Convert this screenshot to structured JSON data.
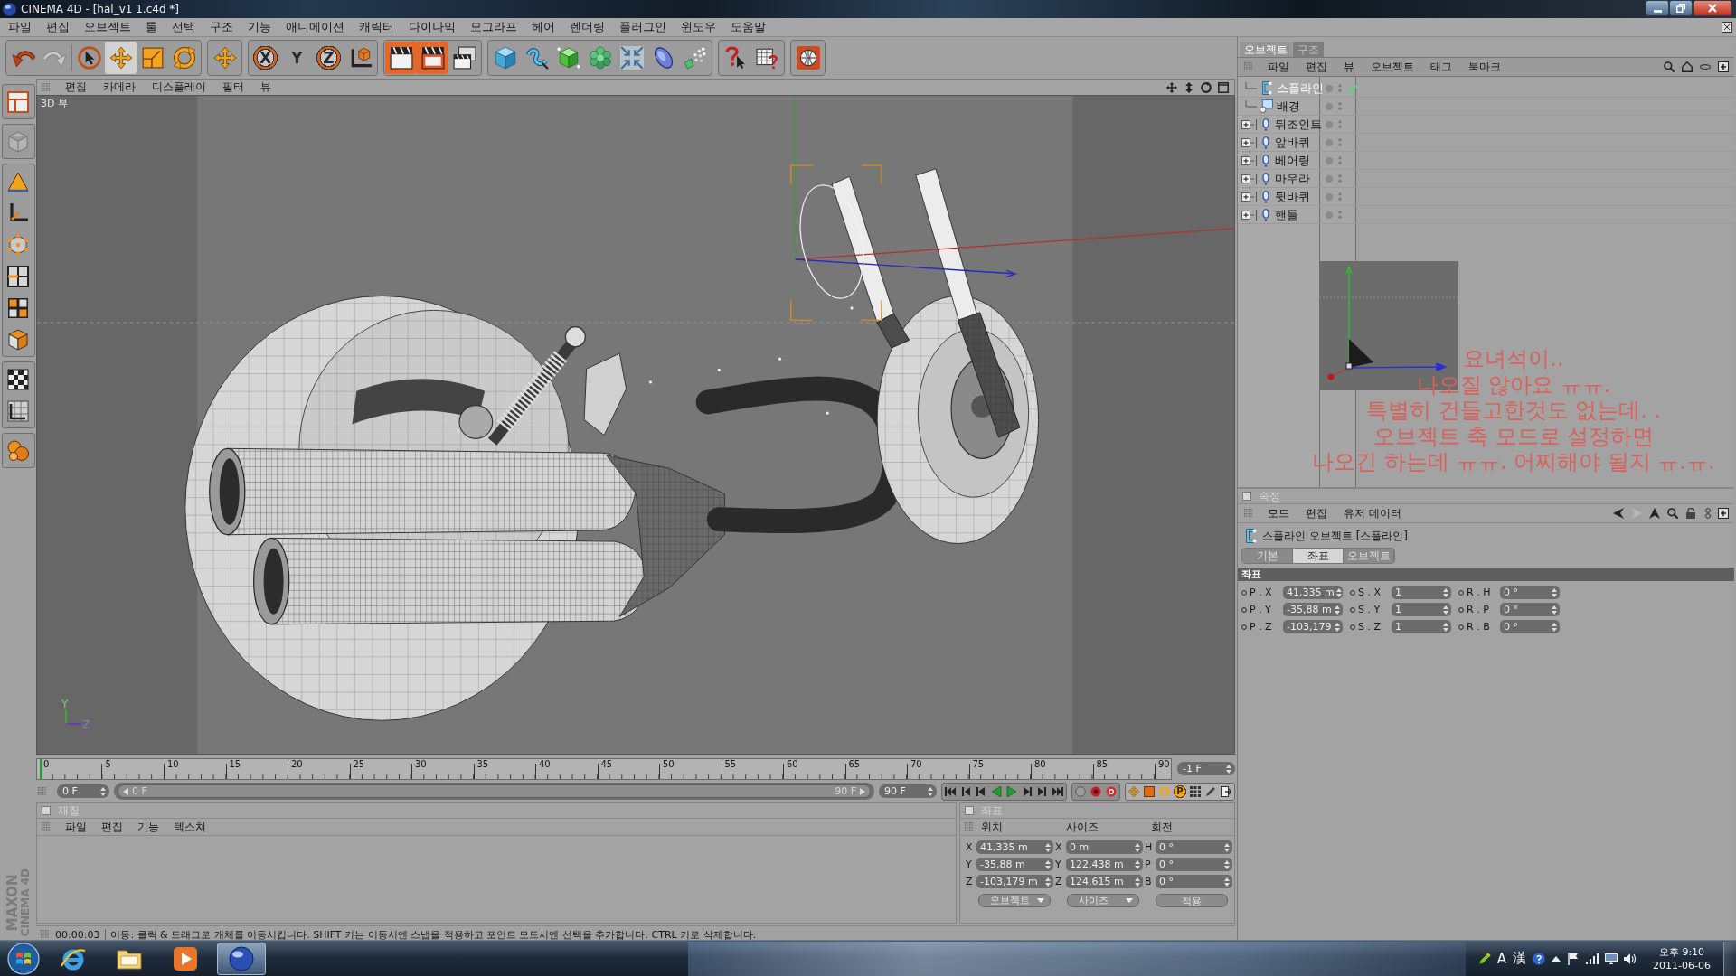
{
  "window": {
    "title": "CINEMA 4D - [hal_v1 1.c4d *]"
  },
  "menu_bar": [
    "파일",
    "편집",
    "오브젝트",
    "툴",
    "선택",
    "구조",
    "기능",
    "애니메이션",
    "캐릭터",
    "다이나믹",
    "모그라프",
    "헤어",
    "렌더링",
    "플러그인",
    "윈도우",
    "도움말"
  ],
  "toolbar": {
    "history": [
      {
        "kind": "undo",
        "disabled": false
      },
      {
        "kind": "redo",
        "disabled": true
      }
    ],
    "tools": [
      {
        "kind": "select",
        "selected": false
      },
      {
        "kind": "move",
        "selected": true
      },
      {
        "kind": "scale",
        "selected": false
      },
      {
        "kind": "rotate",
        "selected": false
      }
    ],
    "axes": [
      {
        "label": "X",
        "on": true
      },
      {
        "label": "Y",
        "on": false
      },
      {
        "label": "Z",
        "on": true
      }
    ]
  },
  "viewport": {
    "menu": [
      "편집",
      "카메라",
      "디스플레이",
      "필터",
      "뷰"
    ],
    "label": "3D 뷰",
    "gizmo_labels": [
      "Y",
      "Z"
    ]
  },
  "timeline": {
    "ticks": [
      "0",
      "5",
      "10",
      "15",
      "20",
      "25",
      "30",
      "35",
      "40",
      "45",
      "50",
      "55",
      "60",
      "65",
      "70",
      "75",
      "80",
      "85",
      "90"
    ],
    "current_frame": "-1 F",
    "start": "0 F",
    "range": {
      "start": "0 F",
      "end": "90 F",
      "level": 1
    },
    "end": "90 F",
    "param_key": "P"
  },
  "material_manager": {
    "title": "재질",
    "menu": [
      "파일",
      "편집",
      "기능",
      "텍스쳐"
    ]
  },
  "coordinates": {
    "title": "좌표",
    "columns": [
      "위치",
      "사이즈",
      "회전"
    ],
    "rows": [
      [
        {
          "axis": "X",
          "value": "41,335 m"
        },
        {
          "axis": "X",
          "value": "0 m"
        },
        {
          "axis": "H",
          "value": "0 °"
        }
      ],
      [
        {
          "axis": "Y",
          "value": "-35,88 m"
        },
        {
          "axis": "Y",
          "value": "122,438 m"
        },
        {
          "axis": "P",
          "value": "0 °"
        }
      ],
      [
        {
          "axis": "Z",
          "value": "-103,179 m"
        },
        {
          "axis": "Z",
          "value": "124,615 m"
        },
        {
          "axis": "B",
          "value": "0 °"
        }
      ]
    ],
    "dropdowns": [
      "오브젝트",
      "사이즈"
    ],
    "apply": "적용"
  },
  "status_bar": {
    "time": "00:00:03",
    "message": "이동: 클릭 & 드래그로 개체를 이동시킵니다. SHIFT 키는 이동시엔 스냅을 적용하고 포인트 모드시엔 선택을 추가합니다. CTRL 키로 삭제합니다."
  },
  "logo": [
    "MAXON",
    "CINEMA 4D"
  ],
  "object_manager": {
    "tabs": [
      {
        "label": "오브젝트",
        "selected": true
      },
      {
        "label": "구조",
        "selected": false
      }
    ],
    "menu": [
      "파일",
      "편집",
      "뷰",
      "오브젝트",
      "태그",
      "북마크"
    ],
    "objects": [
      {
        "name": "스플라인",
        "kind": "spline",
        "selected": true,
        "collapsed": false,
        "enabled_check": true
      },
      {
        "name": "배경",
        "kind": "background",
        "selected": false,
        "collapsed": false,
        "enabled_check": false
      },
      {
        "name": "뒤조인트",
        "kind": "null",
        "selected": false,
        "collapsed": true,
        "enabled_check": false
      },
      {
        "name": "앞바퀴",
        "kind": "null",
        "selected": false,
        "collapsed": true,
        "enabled_check": false
      },
      {
        "name": "베어링",
        "kind": "null",
        "selected": false,
        "collapsed": true,
        "enabled_check": false
      },
      {
        "name": "마우라",
        "kind": "null",
        "selected": false,
        "collapsed": true,
        "enabled_check": false
      },
      {
        "name": "뒷바퀴",
        "kind": "null",
        "selected": false,
        "collapsed": true,
        "enabled_check": false
      },
      {
        "name": "핸들",
        "kind": "null",
        "selected": false,
        "collapsed": true,
        "enabled_check": false
      }
    ]
  },
  "note": {
    "lines": [
      "요녀석이..",
      "나오질 않아요 ㅠㅠ.",
      "특별히 건들고한것도 없는데. .",
      "오브젝트 축 모드로 설정하면",
      "나오긴 하는데 ㅠㅠ. 어찌해야 될지 ㅠ.ㅠ."
    ]
  },
  "attributes": {
    "title": "속성",
    "menu": [
      "모드",
      "편집",
      "유저 데이터"
    ],
    "object_title": "스플라인 오브젝트 [스플라인]",
    "tabs": [
      {
        "label": "기본",
        "selected": false
      },
      {
        "label": "좌표",
        "selected": true
      },
      {
        "label": "오브젝트",
        "selected": false
      }
    ],
    "section": "좌표",
    "rows": [
      [
        {
          "label": "P . X",
          "value": "41,335 m"
        },
        {
          "label": "S . X",
          "value": "1"
        },
        {
          "label": "R . H",
          "value": "0 °"
        }
      ],
      [
        {
          "label": "P . Y",
          "value": "-35,88 m"
        },
        {
          "label": "S . Y",
          "value": "1"
        },
        {
          "label": "R . P",
          "value": "0 °"
        }
      ],
      [
        {
          "label": "P . Z",
          "value": "-103,179"
        },
        {
          "label": "S . Z",
          "value": "1"
        },
        {
          "label": "R . B",
          "value": "0 °"
        }
      ]
    ]
  },
  "taskbar": {
    "apps": [
      {
        "kind": "browser",
        "active": false
      },
      {
        "kind": "folder",
        "active": false
      },
      {
        "kind": "media",
        "active": false
      },
      {
        "kind": "sphere",
        "active": true
      }
    ],
    "ime": [
      "A",
      "漢"
    ],
    "time": "오후 9:10",
    "date": "2011-06-06"
  }
}
